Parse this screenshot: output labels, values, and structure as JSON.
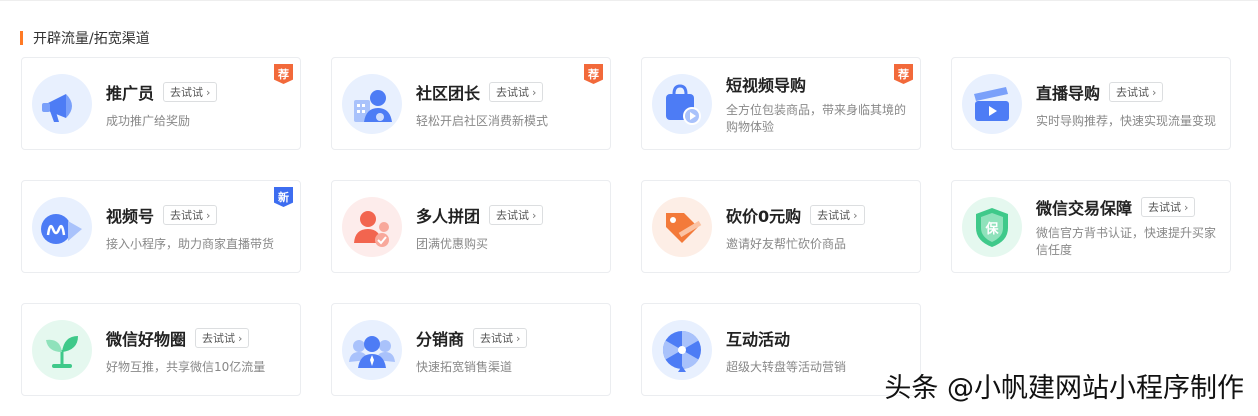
{
  "section_title": "开辟流量/拓宽渠道",
  "try_label": "去试试",
  "cards": [
    {
      "name": "推广员",
      "desc": "成功推广给奖励",
      "badge": "荐"
    },
    {
      "name": "社区团长",
      "desc": "轻松开启社区消费新模式",
      "badge": "荐"
    },
    {
      "name": "短视频导购",
      "desc": "全方位包装商品，带来身临其境的购物体验",
      "badge": "荐"
    },
    {
      "name": "直播导购",
      "desc": "实时导购推荐，快速实现流量变现"
    },
    {
      "name": "视频号",
      "desc": "接入小程序，助力商家直播带货",
      "badge": "新"
    },
    {
      "name": "多人拼团",
      "desc": "团满优惠购买"
    },
    {
      "name": "砍价0元购",
      "desc": "邀请好友帮忙砍价商品"
    },
    {
      "name": "微信交易保障",
      "desc": "微信官方背书认证，快速提升买家信任度",
      "icon_text": "保"
    },
    {
      "name": "微信好物圈",
      "desc": "好物互推，共享微信10亿流量"
    },
    {
      "name": "分销商",
      "desc": "快速拓宽销售渠道"
    },
    {
      "name": "互动活动",
      "desc": "超级大转盘等活动营销"
    }
  ],
  "watermark": "头条 @小帆建网站小程序制作",
  "colors": {
    "accent": "#ff7a25",
    "hot_badge": "#f2693a",
    "new_badge": "#3d6df0",
    "icon_blue": "#4d7cf5",
    "icon_red": "#f2654f",
    "icon_orange": "#f37a3a",
    "icon_green": "#3fc98a"
  }
}
